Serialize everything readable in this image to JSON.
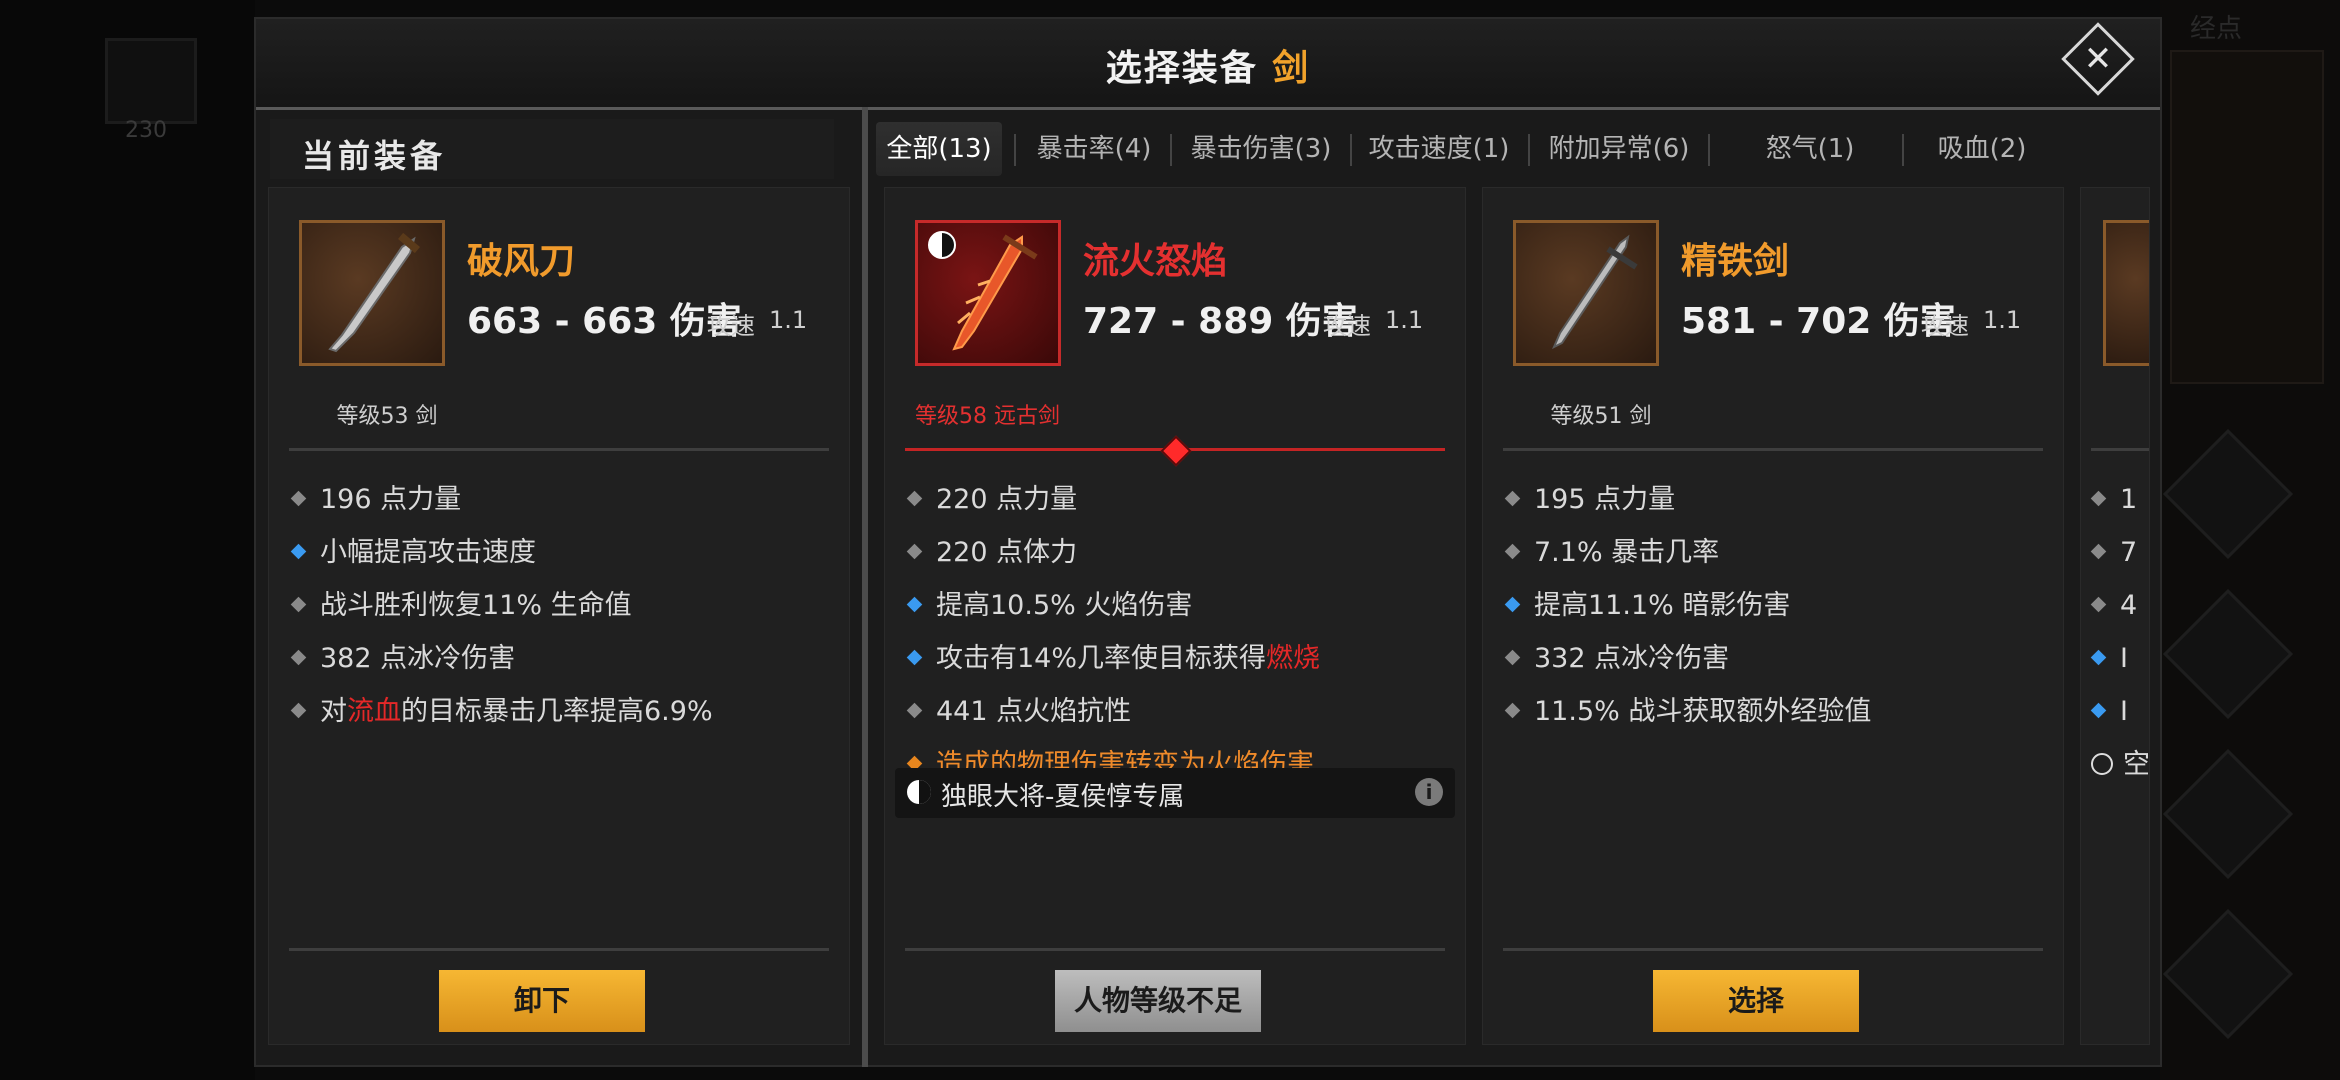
{
  "background": {
    "slot_count": "230",
    "top_right_text": "经点"
  },
  "dialog": {
    "title_prefix": "选择装备",
    "title_accent": "剑",
    "close_symbol": "✕",
    "current_label": "当前装备"
  },
  "tabs": [
    {
      "label": "全部(13)",
      "active": true
    },
    {
      "label": "暴击率(4)"
    },
    {
      "label": "暴击伤害(3)"
    },
    {
      "label": "攻击速度(1)"
    },
    {
      "label": "附加异常(6)"
    },
    {
      "label": "怒气(1)"
    },
    {
      "label": "吸血(2)"
    }
  ],
  "cards": [
    {
      "name": "破风刀",
      "damage": "663 - 663 伤害",
      "speed_label": "攻速",
      "speed_value": "1.1",
      "level": "等级53 剑",
      "stats": [
        {
          "text": "196 点力量",
          "bullet": "gray"
        },
        {
          "text": "小幅提高攻击速度",
          "bullet": "blue"
        },
        {
          "text": "战斗胜利恢复11% 生命值",
          "bullet": "gray"
        },
        {
          "text": "382 点冰冷伤害",
          "bullet": "gray"
        },
        {
          "pre": "对",
          "hl": "流血",
          "post": "的目标暴击几率提高6.9%",
          "bullet": "gray"
        }
      ],
      "button": "卸下"
    },
    {
      "name": "流火怒焰",
      "damage": "727 - 889 伤害",
      "speed_label": "攻速",
      "speed_value": "1.1",
      "level": "等级58 远古剑",
      "stats": [
        {
          "text": "220 点力量",
          "bullet": "gray"
        },
        {
          "text": "220 点体力",
          "bullet": "gray"
        },
        {
          "text": "提高10.5% 火焰伤害",
          "bullet": "blue"
        },
        {
          "pre": "攻击有14%几率使目标获得",
          "hl": "燃烧",
          "post": "",
          "bullet": "blue"
        },
        {
          "text": "441 点火焰抗性",
          "bullet": "gray"
        },
        {
          "text": "造成的物理伤害转变为火焰伤害",
          "bullet": "orange"
        }
      ],
      "set": "独眼大将-夏侯惇专属",
      "info": "i",
      "button": "人物等级不足"
    },
    {
      "name": "精铁剑",
      "damage": "581 - 702 伤害",
      "speed_label": "攻速",
      "speed_value": "1.1",
      "level": "等级51 剑",
      "stats": [
        {
          "text": "195 点力量",
          "bullet": "gray"
        },
        {
          "text": "7.1% 暴击几率",
          "bullet": "gray"
        },
        {
          "text": "提高11.1% 暗影伤害",
          "bullet": "blue"
        },
        {
          "text": "332 点冰冷伤害",
          "bullet": "gray"
        },
        {
          "text": "11.5% 战斗获取额外经验值",
          "bullet": "gray"
        }
      ],
      "button": "选择"
    }
  ],
  "partial_card": {
    "glyphs": [
      "1",
      "7",
      "4",
      "I",
      "I",
      "空"
    ]
  }
}
